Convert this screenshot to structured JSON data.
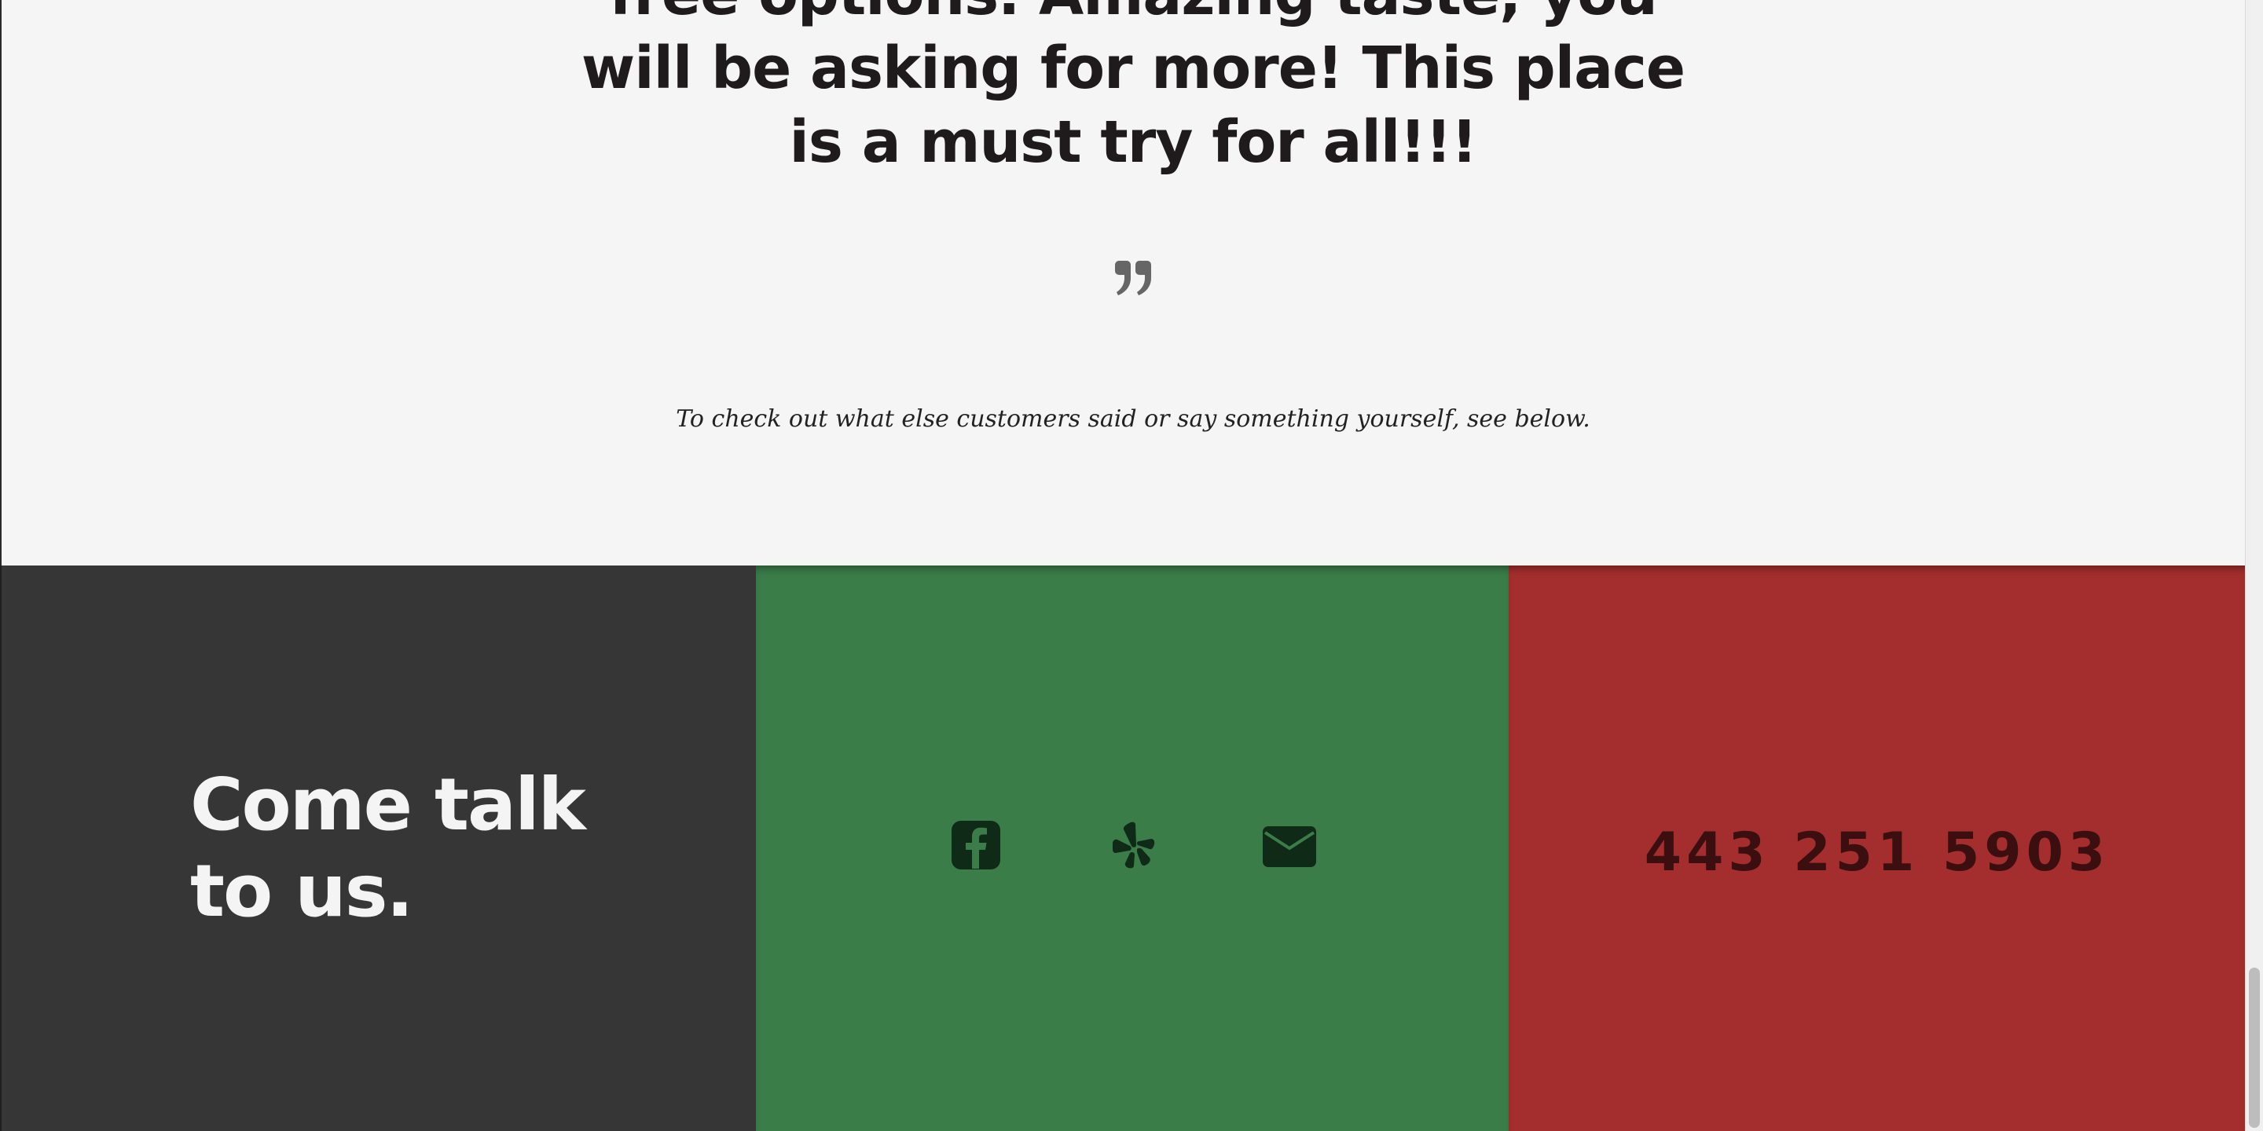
{
  "testimonial": {
    "quote_lines": [
      "free options. Amazing taste, you",
      "will be asking for more! This place",
      "is a must try for all!!!"
    ],
    "quote_icon": "closing-quote-icon",
    "caption": "To check out what else customers said or say something yourself, see below."
  },
  "footer": {
    "talk_line1": "Come talk",
    "talk_line2": "to us.",
    "social": [
      {
        "icon": "facebook-icon"
      },
      {
        "icon": "yelp-icon"
      },
      {
        "icon": "email-icon"
      }
    ],
    "phone": "443 251 5903"
  },
  "colors": {
    "talk_bg": "#363636",
    "social_bg": "#3a7d49",
    "phone_bg": "#a32e2d",
    "icon_color": "#0f2b17",
    "phone_text": "#3b0f10"
  }
}
